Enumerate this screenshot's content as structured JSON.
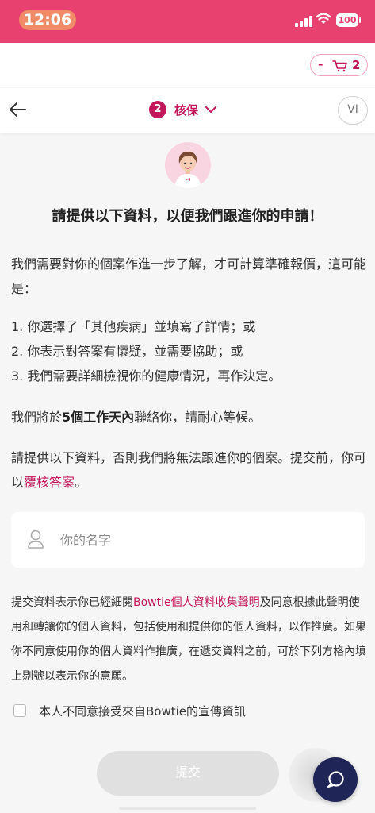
{
  "status_bar": {
    "time": "12:06",
    "battery": "100",
    "background": "#e8416f"
  },
  "cart": {
    "minus_label": "-",
    "count": "2",
    "icon": "cart-icon"
  },
  "nav": {
    "back_icon": "arrow-left-icon",
    "step_number": "2",
    "step_label": "核保",
    "step_chevron_icon": "chevron-down-icon",
    "language": "VI"
  },
  "avatar": {
    "icon": "agent-avatar"
  },
  "headline": "請提供以下資料，以便我們跟進你的申請！",
  "intro": "我們需要對你的個案作進一步了解，才可計算準確報價，這可能是：",
  "reasons": [
    "1. 你選擇了「其他疾病」並填寫了詳情；或",
    "2. 你表示對答案有懷疑，並需要協助；或",
    "3. 我們需要詳細檢視你的健康情況，再作決定。"
  ],
  "contact": {
    "prefix": "我們將於",
    "bold": "5個工作天內",
    "suffix": "聯絡你，請耐心等候。"
  },
  "provide": {
    "text": "請提供以下資料，否則我們將無法跟進你的個案。提交前，你可以",
    "link": "覆核答案",
    "end": "。"
  },
  "name_field": {
    "placeholder": "你的名字",
    "value": "",
    "icon": "user-icon"
  },
  "privacy": {
    "prefix": "提交資料表示你已經細閱",
    "link": "Bowtie個人資料收集聲明",
    "suffix": "及同意根據此聲明使用和轉讓你的個人資料，包括使用和提供你的個人資料，以作推廣。如果你不同意使用你的個人資料作推廣，在遞交資料之前，可於下列方格內填上剔號以表示你的意願。"
  },
  "consent": {
    "label": "本人不同意接受來自Bowtie的宣傳資訊",
    "checked": false
  },
  "submit": {
    "label": "提交"
  },
  "chat": {
    "icon": "chat-icon"
  },
  "colors": {
    "accent": "#c2185b",
    "status_bar": "#e8416f",
    "chat_button": "#1f2657",
    "disabled_button": "#e0e0e0"
  }
}
